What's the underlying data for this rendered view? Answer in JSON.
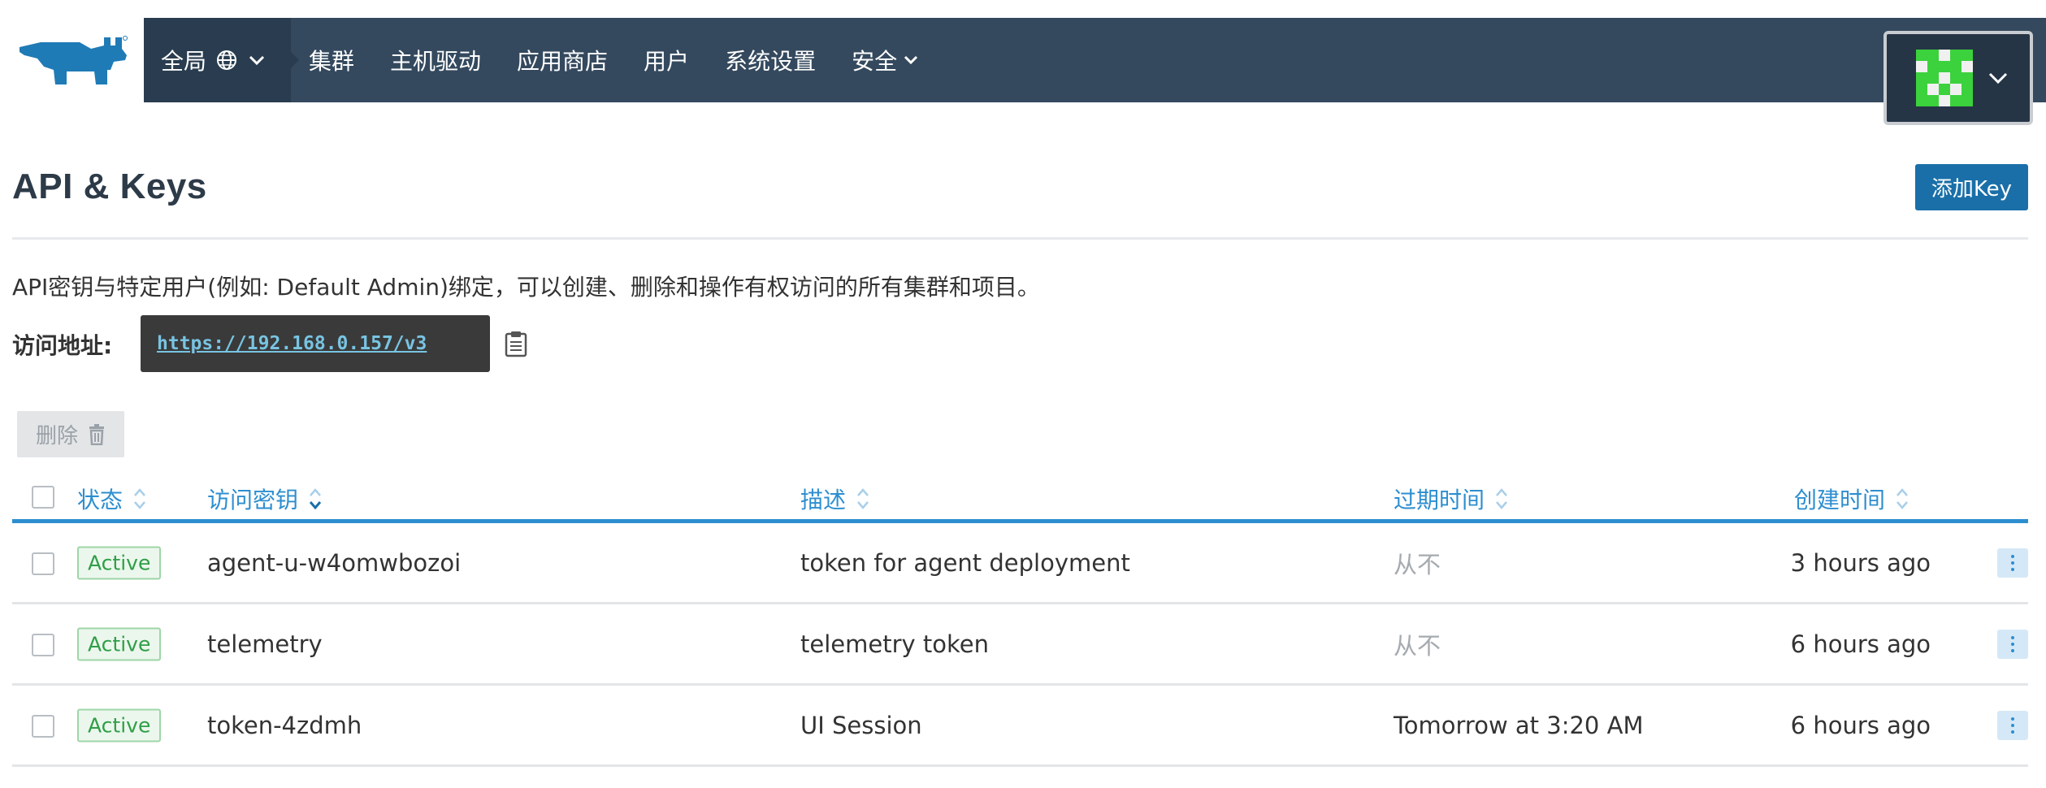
{
  "header": {
    "scope_label": "全局",
    "nav": [
      "集群",
      "主机驱动",
      "应用商店",
      "用户",
      "系统设置",
      "安全"
    ]
  },
  "page": {
    "title": "API & Keys",
    "add_button": "添加Key",
    "description": "API密钥与特定用户(例如: Default Admin)绑定，可以创建、删除和操作有权访问的所有集群和项目。",
    "endpoint_label": "访问地址:",
    "endpoint_url": "https://192.168.0.157/v3",
    "delete_button": "删除"
  },
  "table": {
    "headers": {
      "state": "状态",
      "access_key": "访问密钥",
      "description": "描述",
      "expires": "过期时间",
      "created": "创建时间"
    },
    "rows": [
      {
        "state": "Active",
        "access_key": "agent-u-w4omwbozoi",
        "description": "token for agent deployment",
        "expires": "从不",
        "created": "3 hours ago"
      },
      {
        "state": "Active",
        "access_key": "telemetry",
        "description": "telemetry token",
        "expires": "从不",
        "created": "6 hours ago"
      },
      {
        "state": "Active",
        "access_key": "token-4zdmh",
        "description": "UI Session",
        "expires": "Tomorrow at 3:20 AM",
        "created": "6 hours ago"
      }
    ]
  },
  "colors": {
    "topbar": "#34495e",
    "accent": "#2d8ecf",
    "primary_button": "#1a6fa8",
    "active_badge": "#2f9e46",
    "logo": "#1f7bb6"
  }
}
